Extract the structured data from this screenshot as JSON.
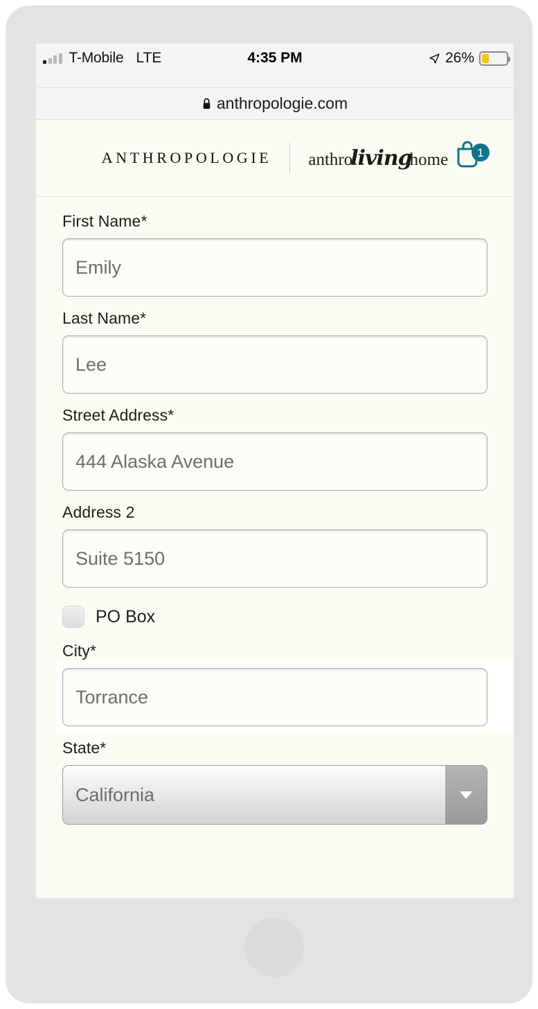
{
  "status_bar": {
    "carrier": "T-Mobile",
    "network": "LTE",
    "time": "4:35 PM",
    "battery_percent": "26%",
    "battery_level": 26,
    "signal_bars_total": 4,
    "signal_bars_active": 1,
    "location_icon": "location-arrow-icon",
    "battery_color": "#f5c518"
  },
  "browser": {
    "url": "anthropologie.com",
    "lock_icon": "lock-icon"
  },
  "site_header": {
    "brand": "ANTHROPOLOGIE",
    "sub_brand_prefix": "anthro",
    "sub_brand_script": "living",
    "sub_brand_suffix": "home",
    "cart_icon": "shopping-bag-icon",
    "cart_count": "1",
    "accent_color": "#10748c"
  },
  "form": {
    "fields": [
      {
        "label": "First Name*",
        "value": "Emily",
        "type": "text"
      },
      {
        "label": "Last Name*",
        "value": "Lee",
        "type": "text"
      },
      {
        "label": "Street Address*",
        "value": "444 Alaska Avenue",
        "type": "text"
      },
      {
        "label": "Address 2",
        "value": "Suite 5150",
        "type": "text"
      },
      {
        "label": "City*",
        "value": "Torrance",
        "type": "text"
      },
      {
        "label": "State*",
        "value": "California",
        "type": "select"
      }
    ],
    "po_box": {
      "label": "PO Box",
      "checked": false
    },
    "select_arrow_icon": "chevron-down-icon"
  }
}
